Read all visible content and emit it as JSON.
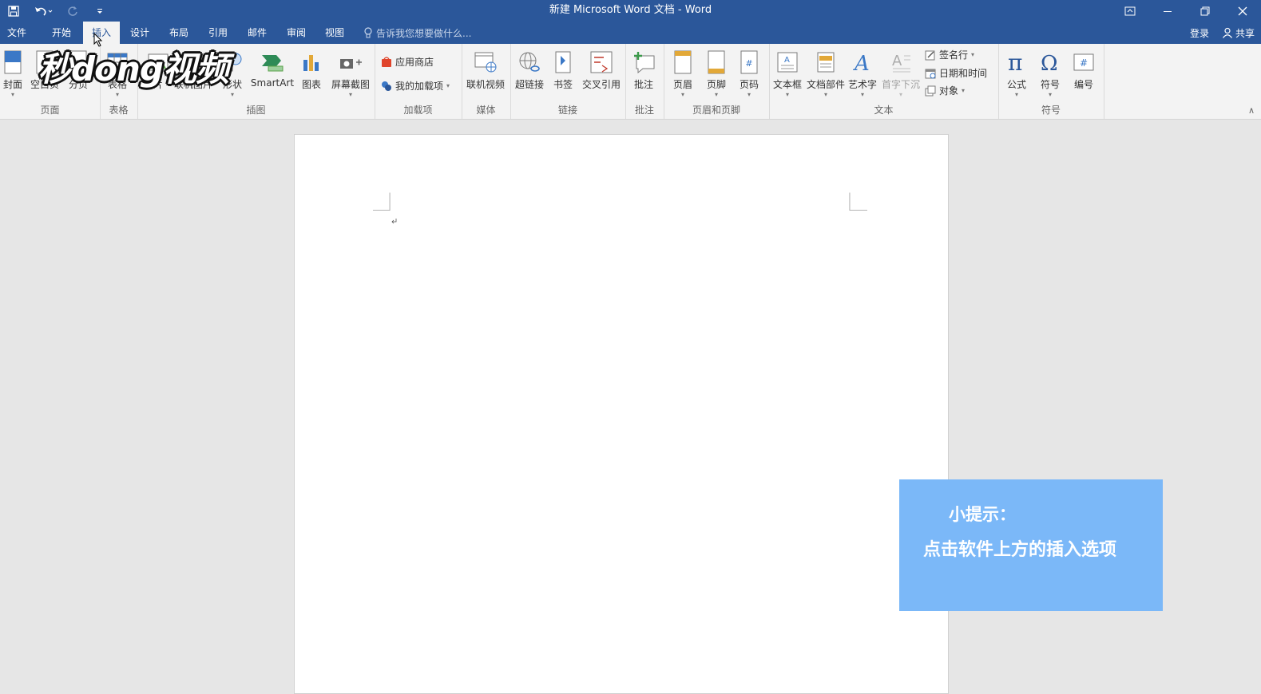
{
  "title": "新建 Microsoft Word 文档 - Word",
  "tabs": [
    "文件",
    "开始",
    "插入",
    "设计",
    "布局",
    "引用",
    "邮件",
    "审阅",
    "视图"
  ],
  "tell_me": "告诉我您想要做什么...",
  "login": "登录",
  "share": "共享",
  "groups": {
    "pages": "页面",
    "table": "表格",
    "illustrations": "插图",
    "addins": "加载项",
    "media": "媒体",
    "links": "链接",
    "comments": "批注",
    "header_footer": "页眉和页脚",
    "text": "文本",
    "symbols": "符号"
  },
  "buttons": {
    "cover": "封面",
    "blank_page": "空白页",
    "page_break": "分页",
    "table": "表格",
    "pictures": "片",
    "online_pictures": "联机图片",
    "shapes": "形状",
    "smartart": "SmartArt",
    "chart": "图表",
    "screenshot": "屏幕截图",
    "store": "应用商店",
    "my_addins": "我的加载项",
    "online_video": "联机视频",
    "hyperlink": "超链接",
    "bookmark": "书签",
    "cross_ref": "交叉引用",
    "comment": "批注",
    "header": "页眉",
    "footer": "页脚",
    "page_number": "页码",
    "text_box": "文本框",
    "quick_parts": "文档部件",
    "wordart": "艺术字",
    "drop_cap": "首字下沉",
    "signature_line": "签名行",
    "date_time": "日期和时间",
    "object": "对象",
    "equation": "公式",
    "symbol": "符号",
    "number": "编号"
  },
  "watermark": "秒dong视频",
  "tip": {
    "line1": "小提示：",
    "line2": "点击软件上方的插入选项"
  },
  "colors": {
    "accent": "#2b579a",
    "tip_bg": "#7bb8f8"
  }
}
